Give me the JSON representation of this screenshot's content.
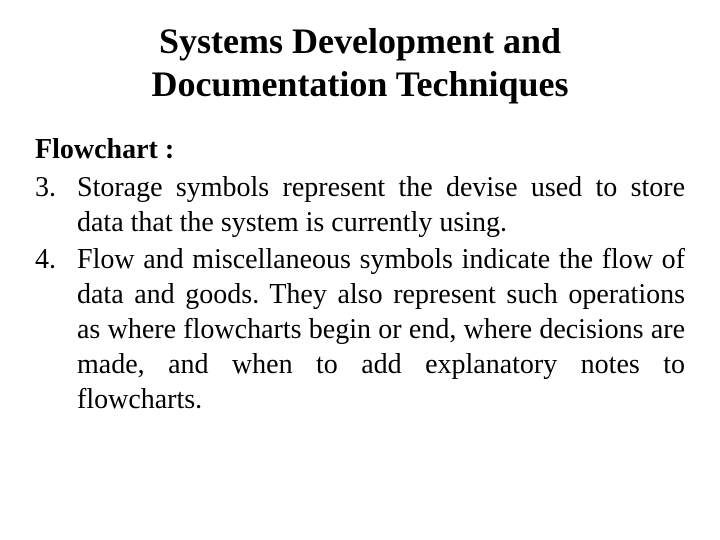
{
  "title_line1": "Systems Development and",
  "title_line2": "Documentation Techniques",
  "subtitle": "Flowchart :",
  "items": [
    {
      "number": "3.",
      "text": "Storage symbols represent the devise used to store data that the system is currently using."
    },
    {
      "number": "4.",
      "text": "Flow and miscellaneous symbols indicate the flow of data and goods. They also represent such operations as where flowcharts begin or end, where decisions are made, and when to add explanatory notes to flowcharts."
    }
  ]
}
